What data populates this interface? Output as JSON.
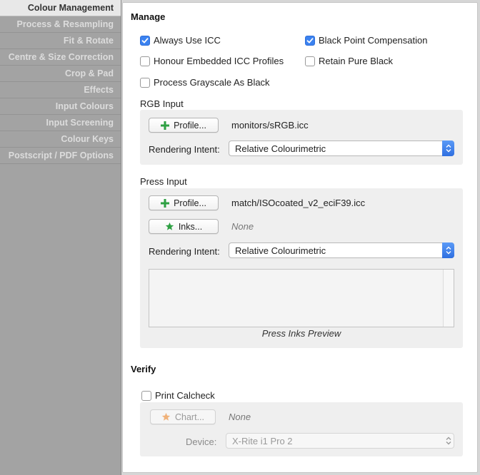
{
  "sidebar": {
    "items": [
      {
        "label": "Colour Management",
        "active": true
      },
      {
        "label": "Process & Resampling"
      },
      {
        "label": "Fit & Rotate"
      },
      {
        "label": "Centre & Size Correction"
      },
      {
        "label": "Crop & Pad"
      },
      {
        "label": "Effects"
      },
      {
        "label": "Input Colours"
      },
      {
        "label": "Input Screening"
      },
      {
        "label": "Colour Keys"
      },
      {
        "label": "Postscript / PDF Options"
      }
    ]
  },
  "manage": {
    "heading": "Manage",
    "always_use_icc": {
      "label": "Always Use ICC",
      "checked": true
    },
    "black_point_compensation": {
      "label": "Black Point Compensation",
      "checked": true
    },
    "honour_embedded": {
      "label": "Honour Embedded ICC Profiles",
      "checked": false
    },
    "retain_pure_black": {
      "label": "Retain Pure Black",
      "checked": false
    },
    "process_grayscale": {
      "label": "Process Grayscale As Black",
      "checked": false
    }
  },
  "rgb_input": {
    "heading": "RGB Input",
    "profile_button": "Profile...",
    "profile_value": "monitors/sRGB.icc",
    "rendering_label": "Rendering Intent:",
    "rendering_value": "Relative Colourimetric"
  },
  "press_input": {
    "heading": "Press Input",
    "profile_button": "Profile...",
    "profile_value": "match/ISOcoated_v2_eciF39.icc",
    "inks_button": "Inks...",
    "inks_value": "None",
    "rendering_label": "Rendering Intent:",
    "rendering_value": "Relative Colourimetric",
    "preview_caption": "Press Inks Preview"
  },
  "verify": {
    "heading": "Verify",
    "print_calcheck": {
      "label": "Print Calcheck",
      "checked": false
    },
    "chart_button": "Chart...",
    "chart_value": "None",
    "device_label": "Device:",
    "device_value": "X-Rite i1 Pro 2"
  },
  "colors": {
    "accent": "#3b82f0",
    "plus_icon": "#2ea043",
    "star_icon": "#2ea043",
    "star_disabled": "#f0b27a"
  }
}
